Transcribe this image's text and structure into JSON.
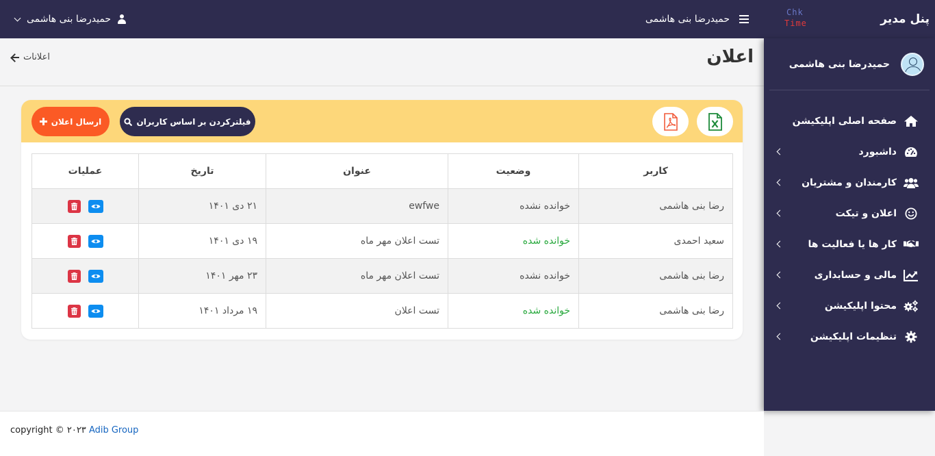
{
  "topbar": {
    "brand_title": "پنل مدیر",
    "logo_line1": "Chk",
    "logo_line2": "Time",
    "center_user": "حمیدرضا بنی هاشمی",
    "left_user": "حمیدرضا بنی هاشمی"
  },
  "sidebar": {
    "user_name": "حمیدرضا بنی هاشمی",
    "items": [
      {
        "label": "صفحه اصلی اپلیکیشن",
        "icon": "home-icon",
        "has_children": false
      },
      {
        "label": "داشبورد",
        "icon": "dashboard-icon",
        "has_children": true
      },
      {
        "label": "کارمندان و مشتریان",
        "icon": "users-icon",
        "has_children": true
      },
      {
        "label": "اعلان و تیکت",
        "icon": "smile-icon",
        "has_children": true
      },
      {
        "label": "کار ها یا فعالیت ها",
        "icon": "handshake-icon",
        "has_children": true
      },
      {
        "label": "مالی و حسابداری",
        "icon": "chart-line-icon",
        "has_children": true
      },
      {
        "label": "محتوا اپلیکیشن",
        "icon": "cogs-icon",
        "has_children": true
      },
      {
        "label": "تنظیمات اپلیکیشن",
        "icon": "gear-icon",
        "has_children": true
      }
    ]
  },
  "header": {
    "title": "اعلان",
    "breadcrumb": "اعلانات"
  },
  "toolbar": {
    "send_label": "ارسال اعلان",
    "filter_label": "فیلترکردن بر اساس کاربران",
    "excel_icon": "excel-file-icon",
    "pdf_icon": "pdf-file-icon"
  },
  "table": {
    "columns": [
      "کاربر",
      "وضعیت",
      "عنوان",
      "تاریخ",
      "عملیات"
    ],
    "rows": [
      {
        "user": "رضا بنی هاشمی",
        "status": "خوانده نشده",
        "read": false,
        "title": "ewfwe",
        "date": "۲۱ دی ۱۴۰۱"
      },
      {
        "user": "سعید احمدی",
        "status": "خوانده شده",
        "read": true,
        "title": "تست اعلان مهر ماه",
        "date": "۱۹ دی ۱۴۰۱"
      },
      {
        "user": "رضا بنی هاشمی",
        "status": "خوانده نشده",
        "read": false,
        "title": "تست اعلان مهر ماه",
        "date": "۲۳ مهر ۱۴۰۱"
      },
      {
        "user": "رضا بنی هاشمی",
        "status": "خوانده شده",
        "read": true,
        "title": "تست اعلان",
        "date": "۱۹ مرداد ۱۴۰۱"
      }
    ]
  },
  "footer": {
    "copyright": "copyright © ۲۰۲۳",
    "company": "Adib Group"
  },
  "colors": {
    "primary_dark": "#2e2c4f",
    "toolbar_yellow": "#fdd77a",
    "send_orange": "#fb5a25",
    "read_green": "#27a83c",
    "view_blue": "#0d8df0",
    "delete_red": "#dc3545",
    "link_blue": "#1565c0"
  }
}
